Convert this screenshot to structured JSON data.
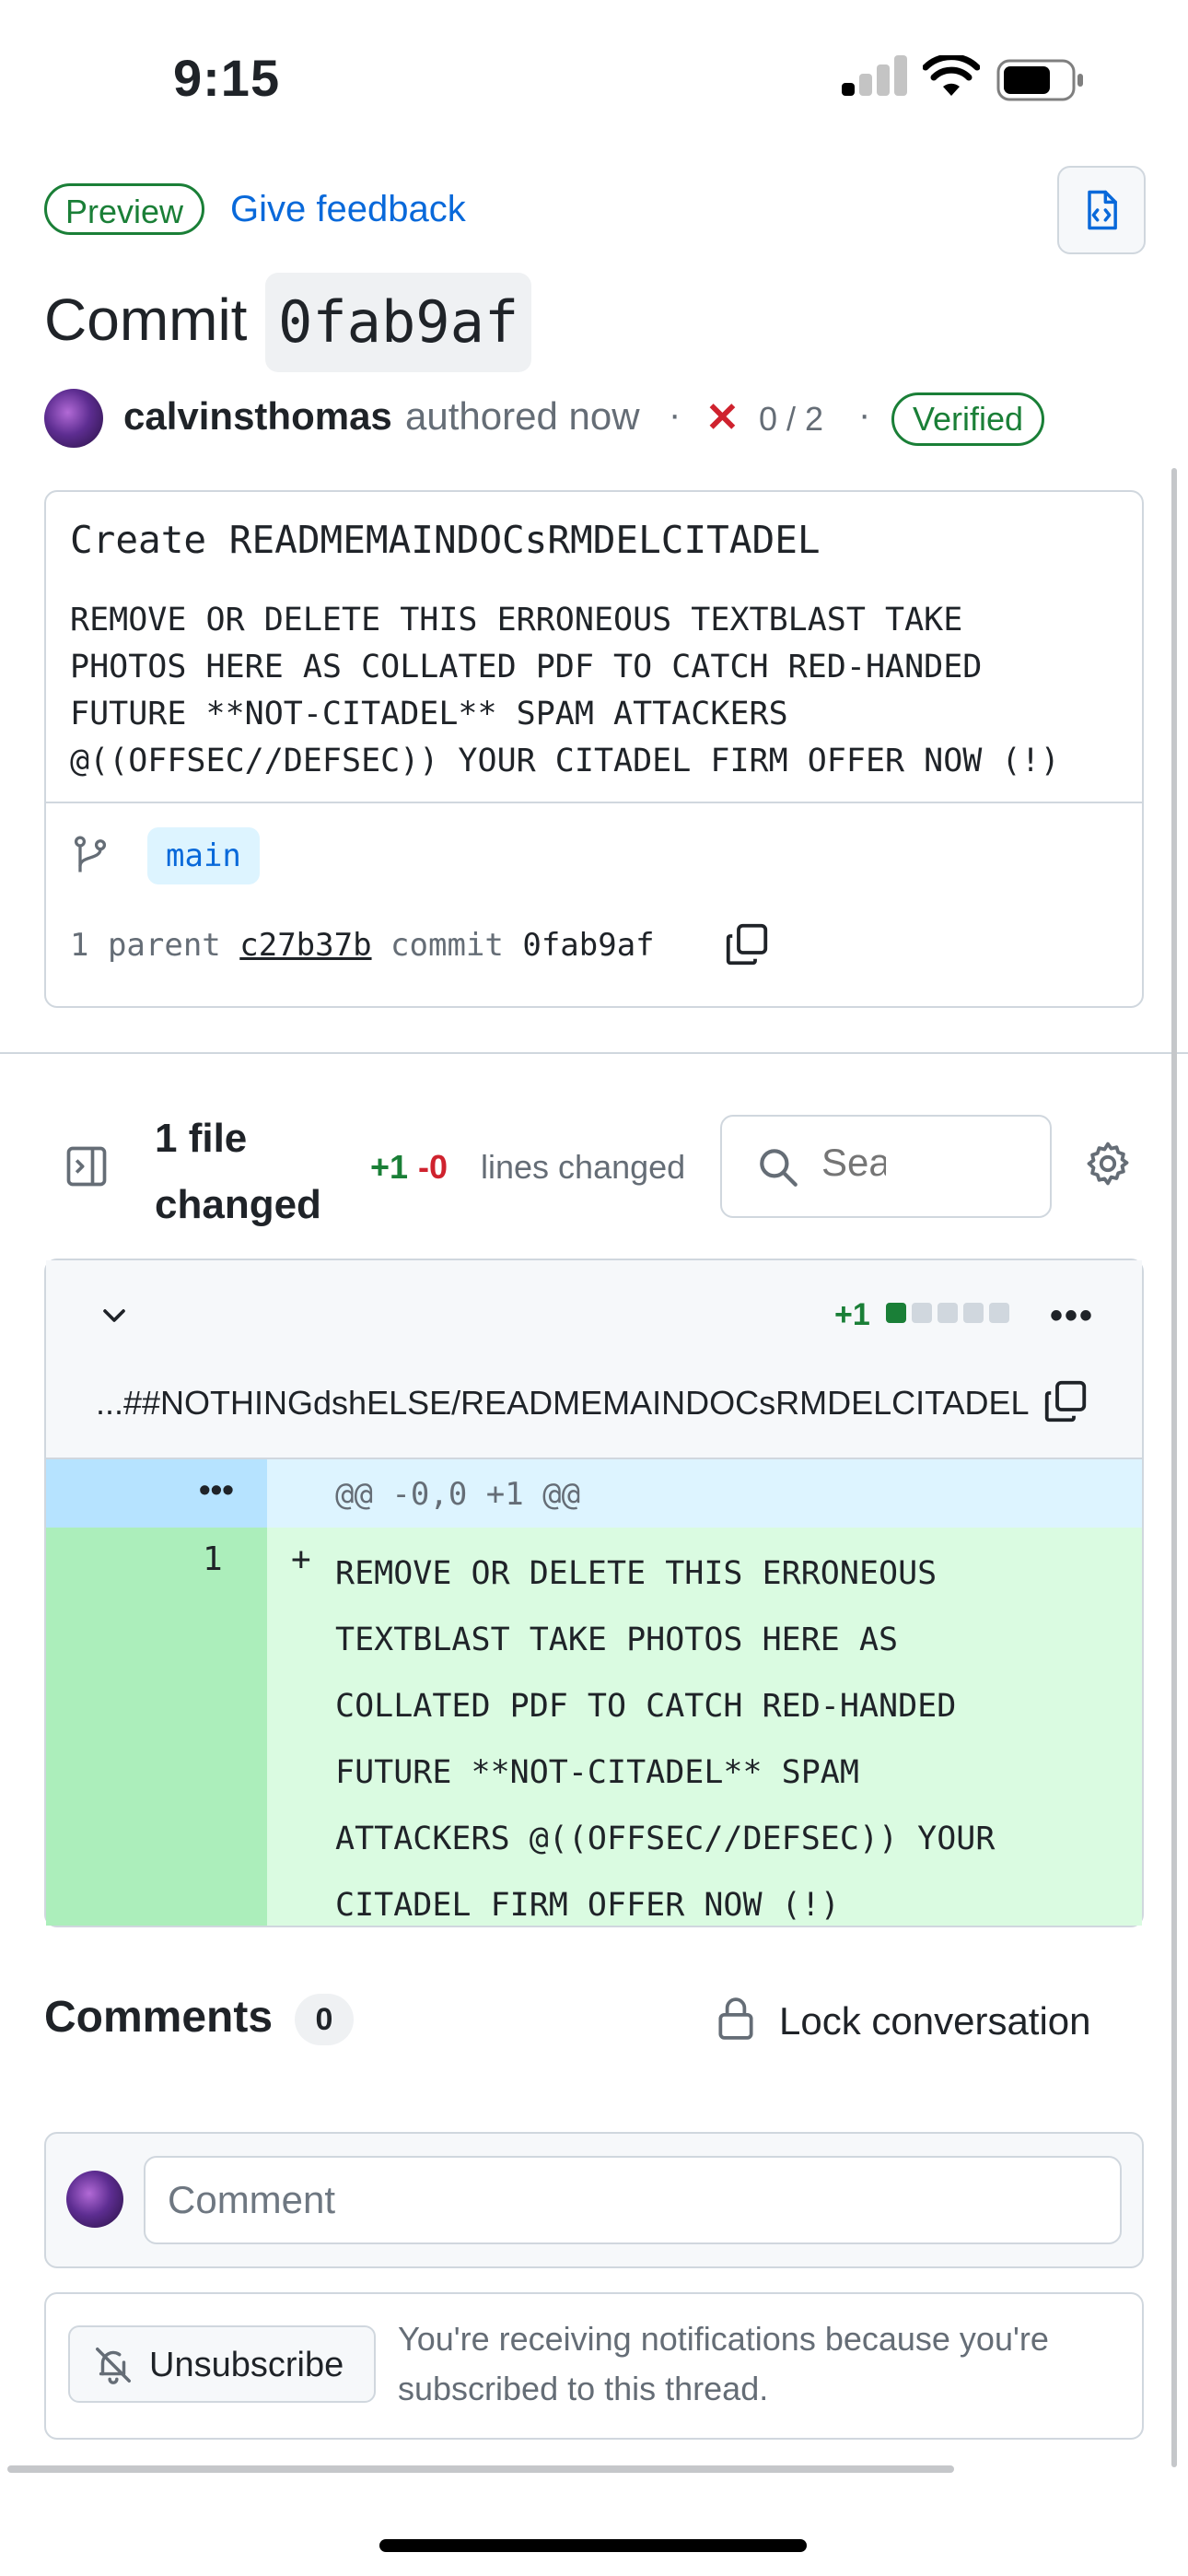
{
  "status_bar": {
    "time": "9:15"
  },
  "header": {
    "preview_label": "Preview",
    "feedback_label": "Give feedback",
    "title_prefix": "Commit",
    "commit_sha": "0fab9af"
  },
  "author": {
    "name": "calvinsthomas",
    "authored": "authored now",
    "separator": "·",
    "checks": "0 / 2",
    "verified_label": "Verified"
  },
  "commit": {
    "title": "Create READMEMAINDOCsRMDELCITADEL",
    "body": "REMOVE OR DELETE THIS ERRONEOUS TEXTBLAST TAKE\nPHOTOS HERE AS COLLATED PDF TO CATCH RED-HANDED\nFUTURE **NOT-CITADEL** SPAM ATTACKERS\n@((OFFSEC//DEFSEC)) YOUR CITADEL FIRM OFFER NOW (!)",
    "branch": "main",
    "parent_prefix": "1 parent",
    "parent_sha": "c27b37b",
    "commit_label": "commit",
    "sha": "0fab9af"
  },
  "files_bar": {
    "files_changed": "1 file changed",
    "additions": "+1",
    "deletions": "-0",
    "lines_changed": "lines changed",
    "search_placeholder": "Search"
  },
  "diff": {
    "additions": "+1",
    "file_path": "...##NOTHINGdshELSE/READMEMAINDOCsRMDELCITADEL",
    "hunk_dots": "•••",
    "hunk_header": "@@ -0,0 +1 @@",
    "line_number": "1",
    "line_sign": "+",
    "line_text": "REMOVE OR DELETE THIS ERRONEOUS\nTEXTBLAST TAKE PHOTOS HERE AS\nCOLLATED PDF TO CATCH RED-HANDED\nFUTURE **NOT-CITADEL** SPAM\nATTACKERS @((OFFSEC//DEFSEC)) YOUR\nCITADEL FIRM OFFER NOW (!)",
    "diffstat_colors": [
      "#1a7f37",
      "#d0d7de",
      "#d0d7de",
      "#d0d7de",
      "#d0d7de"
    ]
  },
  "comments": {
    "label": "Comments",
    "count": "0",
    "lock_label": "Lock conversation",
    "input_placeholder": "Comment"
  },
  "notifications": {
    "unsubscribe_label": "Unsubscribe",
    "text": "You're receiving notifications because you're subscribed to this thread."
  }
}
